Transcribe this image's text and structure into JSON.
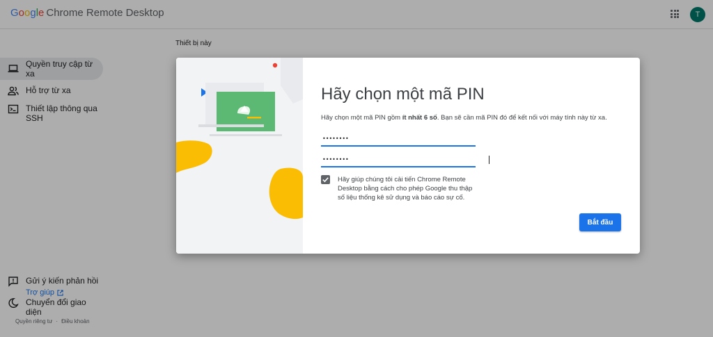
{
  "app": {
    "logo_text": "Google",
    "product_name": "Chrome Remote Desktop",
    "avatar_initial": "T",
    "avatar_color": "#00796b"
  },
  "sidebar": {
    "items": [
      {
        "label": "Quyền truy cập từ xa",
        "icon": "laptop-icon",
        "active": true
      },
      {
        "label": "Hỗ trợ từ xa",
        "icon": "people-icon",
        "active": false
      },
      {
        "label": "Thiết lập thông qua SSH",
        "icon": "terminal-icon",
        "active": false
      }
    ],
    "help_label": "Trợ giúp",
    "feedback_label": "Gửi ý kiến phản hồi",
    "theme_label": "Chuyển đổi giao diện",
    "privacy_label": "Quyền riêng tư",
    "footer_separator": "·",
    "terms_label": "Điều khoản"
  },
  "main": {
    "section_title": "Thiết bị này"
  },
  "dialog": {
    "title": "Hãy chọn một mã PIN",
    "desc_prefix": "Hãy chọn một mã PIN gồm ",
    "desc_bold": "ít nhất 6 số",
    "desc_suffix": ". Bạn sẽ cần mã PIN đó để kết nối với máy tính này từ xa.",
    "pin_value": "••••••••",
    "pin_confirm_value": "••••••••",
    "consent_checked": true,
    "consent_text": "Hãy giúp chúng tôi cải tiến Chrome Remote Desktop bằng cách cho phép Google thu thập số liệu thống kê sử dụng và báo cáo sự cố.",
    "start_label": "Bắt đầu"
  },
  "colors": {
    "accent": "#1a73e8",
    "illustration_green": "#5bb974",
    "illustration_yellow": "#fbbc04",
    "illustration_red": "#ea4335"
  }
}
